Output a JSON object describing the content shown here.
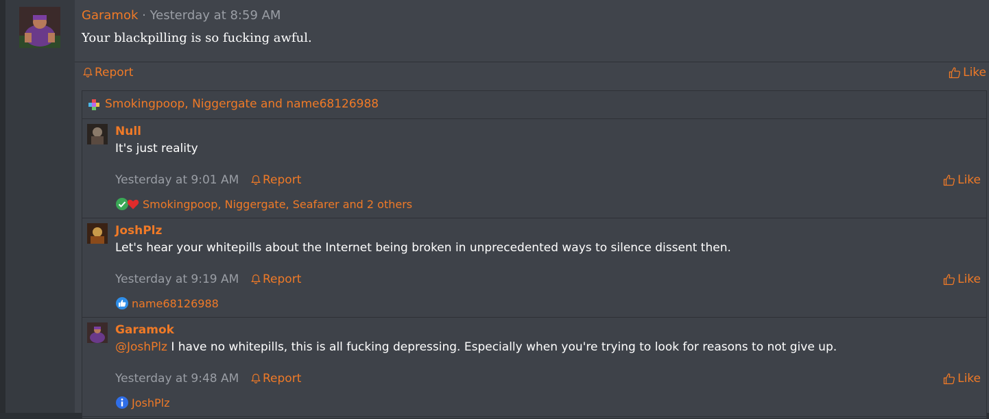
{
  "post": {
    "author": "Garamok",
    "separator": " · ",
    "time": "Yesterday at 8:59 AM",
    "text": "Your blackpilling is so fucking awful.",
    "report_label": "Report",
    "like_label": "Like"
  },
  "reactions_summary": {
    "text": "Smokingpoop, Niggergate and name68126988",
    "icon": "reaction-plus-icon"
  },
  "replies": [
    {
      "author": "Null",
      "text": "It's just reality",
      "time": "Yesterday at 9:01 AM",
      "report_label": "Report",
      "like_label": "Like",
      "reactors": "Smokingpoop, Niggergate, Seafarer and 2 others",
      "reaction_icons": [
        "check-icon",
        "heart-icon"
      ]
    },
    {
      "author": "JoshPlz",
      "text": "Let's hear your whitepills about the Internet being broken in unprecedented ways to silence dissent then.",
      "time": "Yesterday at 9:19 AM",
      "report_label": "Report",
      "like_label": "Like",
      "reactors": "name68126988",
      "reaction_icons": [
        "like-icon"
      ]
    },
    {
      "author": "Garamok",
      "mention": "@JoshPlz",
      "text": " I have no whitepills, this is all fucking depressing. Especially when you're trying to look for reasons to not give up.",
      "time": "Yesterday at 9:48 AM",
      "report_label": "Report",
      "like_label": "Like",
      "reactors": "JoshPlz",
      "reaction_icons": [
        "info-icon"
      ]
    }
  ],
  "colors": {
    "accent": "#f07a27",
    "background": "#40444b",
    "muted_text": "#9a9ea5"
  }
}
